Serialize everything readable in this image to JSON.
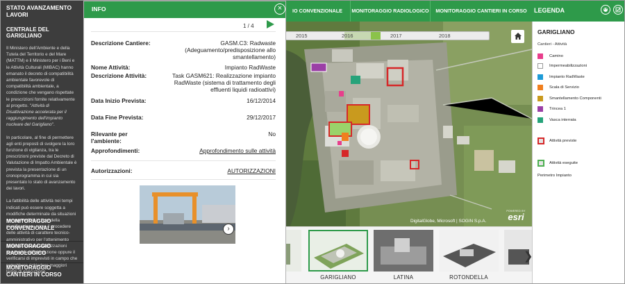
{
  "sidebar": {
    "title": "STATO AVANZAMENTO LAVORI",
    "subtitle": "CENTRALE DEL GARIGLIANO",
    "para1_a": "Il Ministero dell'Ambiente e della Tutela del Territorio e del Mare (MATTM) e il Ministero per i Beni e le Attività Culturali (MIBAC) hanno emanato il decreto di compatibilità ambientale favorevole di compatibilità ambientale, a condizione che vengano rispettate le prescrizioni fornite relativamente al progetto. \"",
    "para1_i": "Attività di Disattivazione accelerata per il raggiungimento dell'impianto nucleare del Garigliano",
    "para1_b": "\".",
    "para2": "In particolare, al fine di permettere agli enti preposti di svolgere la loro funzione di vigilanza, tra le prescrizioni previste dal Decreto di Valutazione di Impatto Ambientale è prevista la presentazione di un cronoprogramma in cui sia presentato lo stato di avanzamento dei lavori.",
    "para3": "La fattibilità delle attività nei tempi indicati può essere soggetta a modifiche determinate da situazioni non prevedibili in fase della pianificazione, come il procedere delle attività di carattere tecnico-amministrativo per l'ottenimento delle necessarie autorizzazioni necessarie all'esecuzione oppure il verificarsi di imprevisti in campo che potrebbero richiedere maggiori tempi di esecuzione.",
    "nav": [
      {
        "label": "MONITORAGGIO CONVENZIONALE"
      },
      {
        "label": "MONITORAGGIO RADIOLOGICO"
      },
      {
        "label": "MONITORAGGIO CANTIERI IN CORSO"
      }
    ]
  },
  "topnav": {
    "tabs": [
      {
        "label": "IO CONVENZIONALE"
      },
      {
        "label": "MONITORAGGIO RADIOLOGICO"
      },
      {
        "label": "MONITORAGGIO CANTIERI IN CORSO"
      }
    ]
  },
  "info": {
    "title": "INFO",
    "close_icon": "close-icon",
    "pager": "1 / 4",
    "fields": [
      {
        "key": "Descrizione Cantiere:",
        "value": "GASM.C3: Radwaste (Adeguamento/predisposizione allo smantellamento)"
      },
      {
        "key": "Nome Attività:",
        "value": "Impianto RadWaste"
      },
      {
        "key": "Descrizione Attività:",
        "value": "Task GASM621: Realizzazione impianto RadWaste (sistema di trattamento degli effluenti liquidi radioattivi)"
      },
      {
        "key": "Data Inizio Prevista:",
        "value": "16/12/2014"
      },
      {
        "key": "Data Fine Prevista:",
        "value": "29/12/2017"
      },
      {
        "key": "Rilevante per l'ambiente:",
        "value": "No"
      },
      {
        "key": "Approfondimenti:",
        "value": "Approfondimento sulle attività"
      },
      {
        "key": "Autorizzazioni:",
        "value": "AUTORIZZAZIONI"
      }
    ]
  },
  "timeline": {
    "years": [
      "2015",
      "2016",
      "2017",
      "2018"
    ],
    "selected": "2016"
  },
  "map": {
    "credits": "DigitalGlobe, Microsoft | SOGIN S.p.A.",
    "powered_by": "POWERED BY",
    "esri": "esri",
    "home_icon": "home-icon"
  },
  "thumbnails": [
    {
      "label": ""
    },
    {
      "label": "GARIGLIANO",
      "selected": true
    },
    {
      "label": "LATINA"
    },
    {
      "label": "ROTONDELLA"
    },
    {
      "label": ""
    }
  ],
  "legend": {
    "header": "LEGENDA",
    "site": "GARIGLIANO",
    "cantieri_label": "Cantieri - Attività",
    "items": [
      {
        "label": "Camino",
        "color": "#e83e8c"
      },
      {
        "label": "Impermeabilizzazioni",
        "color": "#ffffff"
      },
      {
        "label": "Impianto RadWaste",
        "color": "#1e9bd7"
      },
      {
        "label": "Scala di Servizio",
        "color": "#f07f1e"
      },
      {
        "label": "Smantellamento Componenti",
        "color": "#c99a1e"
      },
      {
        "label": "Trincea 1",
        "color": "#9b3fa6"
      },
      {
        "label": "Vasca interrata",
        "color": "#26a37a"
      },
      {
        "label": "Attività previste",
        "color": "#d62728"
      },
      {
        "label": "Attività eseguite",
        "color": "#4caf50"
      },
      {
        "label": "Perimetro Impianto",
        "color": "#ffffff"
      }
    ]
  },
  "colors": {
    "accent": "#2e9a4a",
    "sidebar": "#3d3d3d"
  }
}
